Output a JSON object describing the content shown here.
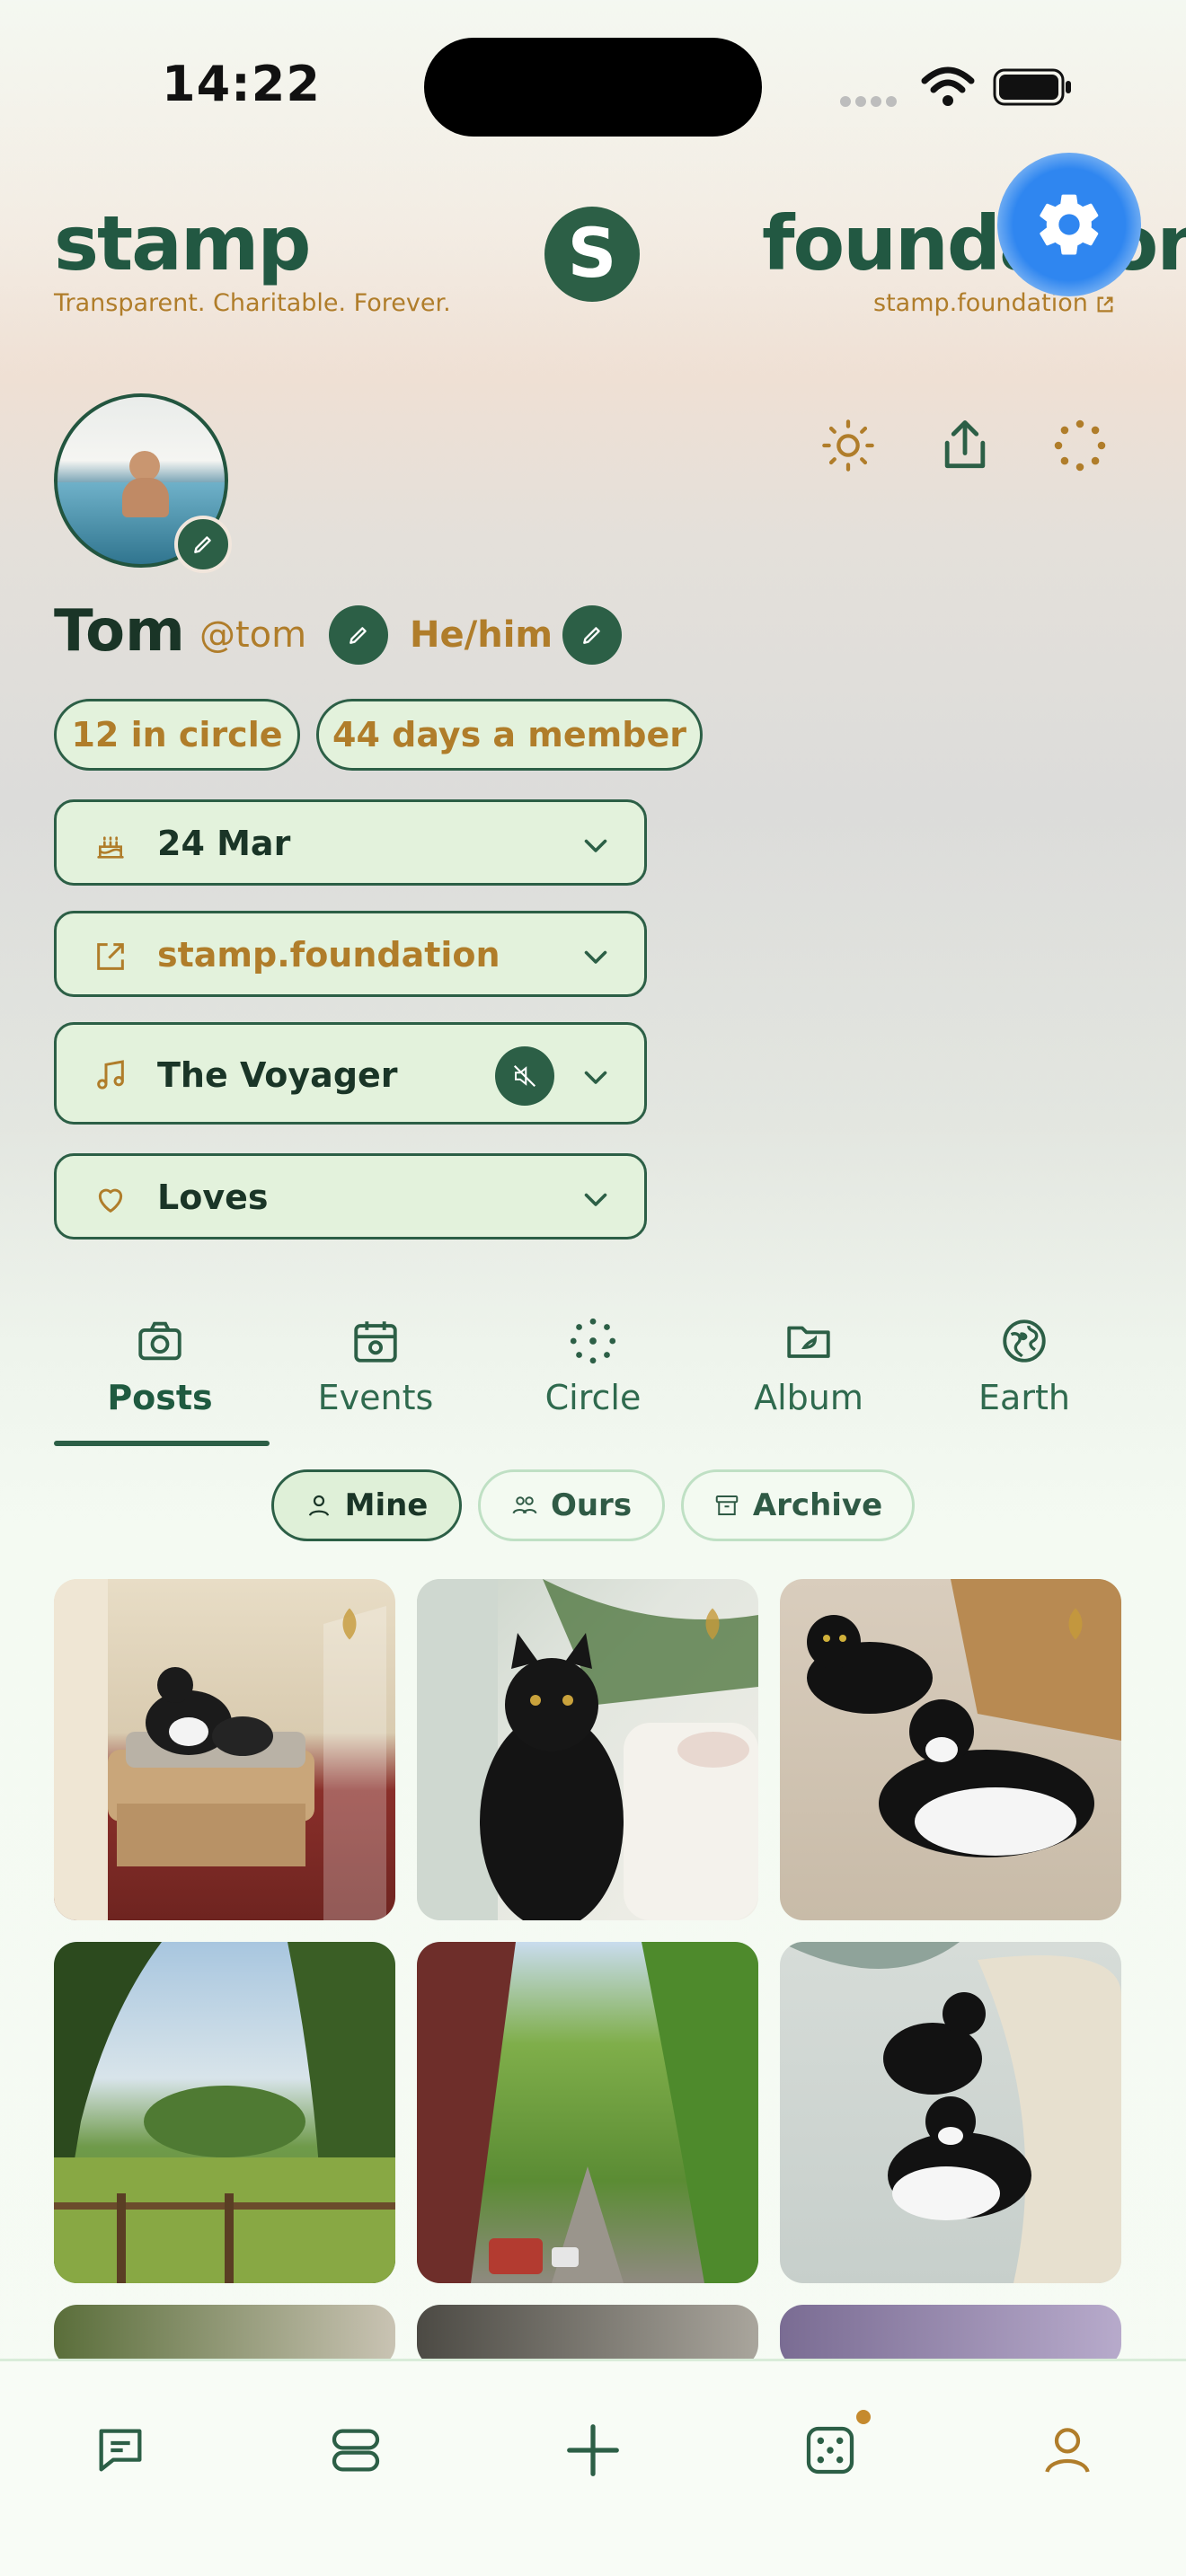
{
  "status_bar": {
    "time": "14:22"
  },
  "header": {
    "brand_left": "stamp",
    "tagline": "Transparent. Charitable. Forever.",
    "logo_letter": "S",
    "brand_right": "foundation",
    "site_link": "stamp.foundation"
  },
  "profile": {
    "name": "Tom",
    "handle": "@tom",
    "pronouns": "He/him",
    "circle_count": "12 in circle",
    "member_for": "44 days a member",
    "birthday": "24 Mar",
    "website": "stamp.foundation",
    "song": "The Voyager",
    "loves": "Loves"
  },
  "tabs": [
    {
      "label": "Posts",
      "icon": "camera-icon",
      "active": true
    },
    {
      "label": "Events",
      "icon": "calendar-icon",
      "active": false
    },
    {
      "label": "Circle",
      "icon": "dots-circle-icon",
      "active": false
    },
    {
      "label": "Album",
      "icon": "folder-icon",
      "active": false
    },
    {
      "label": "Earth",
      "icon": "globe-icon",
      "active": false
    }
  ],
  "filters": [
    {
      "label": "Mine",
      "icon": "person-icon",
      "active": true
    },
    {
      "label": "Ours",
      "icon": "people-icon",
      "active": false
    },
    {
      "label": "Archive",
      "icon": "archive-icon",
      "active": false
    }
  ],
  "photos": [
    {
      "subject": "cats on wicker footstool",
      "marked": true
    },
    {
      "subject": "black cat licking paw",
      "marked": true
    },
    {
      "subject": "two cats on carpet",
      "marked": true
    },
    {
      "subject": "park meadow with fence",
      "marked": false
    },
    {
      "subject": "tree-lined street",
      "marked": false
    },
    {
      "subject": "two cats beside sofa",
      "marked": false
    }
  ],
  "bottom_nav": [
    "chat-icon",
    "feed-icon",
    "add-icon",
    "dice-icon",
    "profile-icon"
  ],
  "colors": {
    "primary": "#2c5f46",
    "accent": "#b07d2a",
    "surface": "#e3f2dc",
    "fab": "#2f86f0"
  }
}
